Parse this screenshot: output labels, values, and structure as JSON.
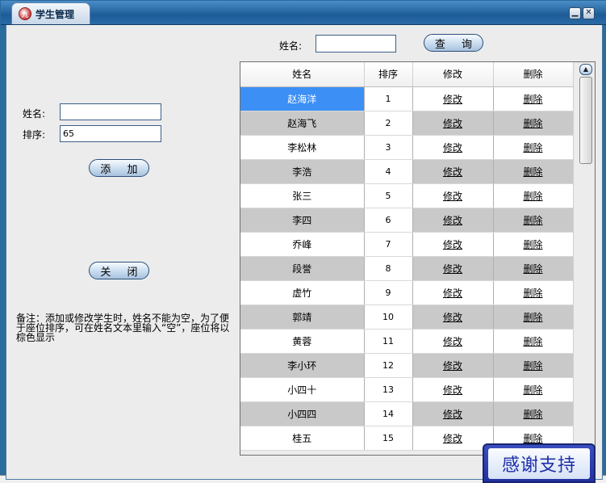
{
  "window": {
    "title": "学生管理",
    "app_icon_glyph": "九"
  },
  "search": {
    "label": "姓名:",
    "value": "",
    "button": "查 询"
  },
  "form": {
    "name_label": "姓名:",
    "name_value": "",
    "order_label": "排序:",
    "order_value": "65",
    "add_button": "添 加",
    "close_button": "关 闭"
  },
  "note": "备注：添加或修改学生时，姓名不能为空，为了便于座位排序，可在姓名文本里输入“空”，座位将以棕色显示",
  "table": {
    "headers": [
      "姓名",
      "排序",
      "修改",
      "删除"
    ],
    "edit_label": "修改",
    "delete_label": "删除",
    "selected_index": 0,
    "rows": [
      {
        "name": "赵海洋",
        "order": "1"
      },
      {
        "name": "赵海飞",
        "order": "2"
      },
      {
        "name": "李松林",
        "order": "3"
      },
      {
        "name": "李浩",
        "order": "4"
      },
      {
        "name": "张三",
        "order": "5"
      },
      {
        "name": "李四",
        "order": "6"
      },
      {
        "name": "乔峰",
        "order": "7"
      },
      {
        "name": "段誉",
        "order": "8"
      },
      {
        "name": "虚竹",
        "order": "9"
      },
      {
        "name": "郭靖",
        "order": "10"
      },
      {
        "name": "黄蓉",
        "order": "11"
      },
      {
        "name": "李小环",
        "order": "12"
      },
      {
        "name": "小四十",
        "order": "13"
      },
      {
        "name": "小四四",
        "order": "14"
      },
      {
        "name": "桂五",
        "order": "15"
      }
    ]
  },
  "banner": {
    "text": "感谢支持"
  },
  "colors": {
    "selected": "#3c8ff5",
    "stripe": "#c9c9c9",
    "titlebar": "#1d5c98"
  }
}
